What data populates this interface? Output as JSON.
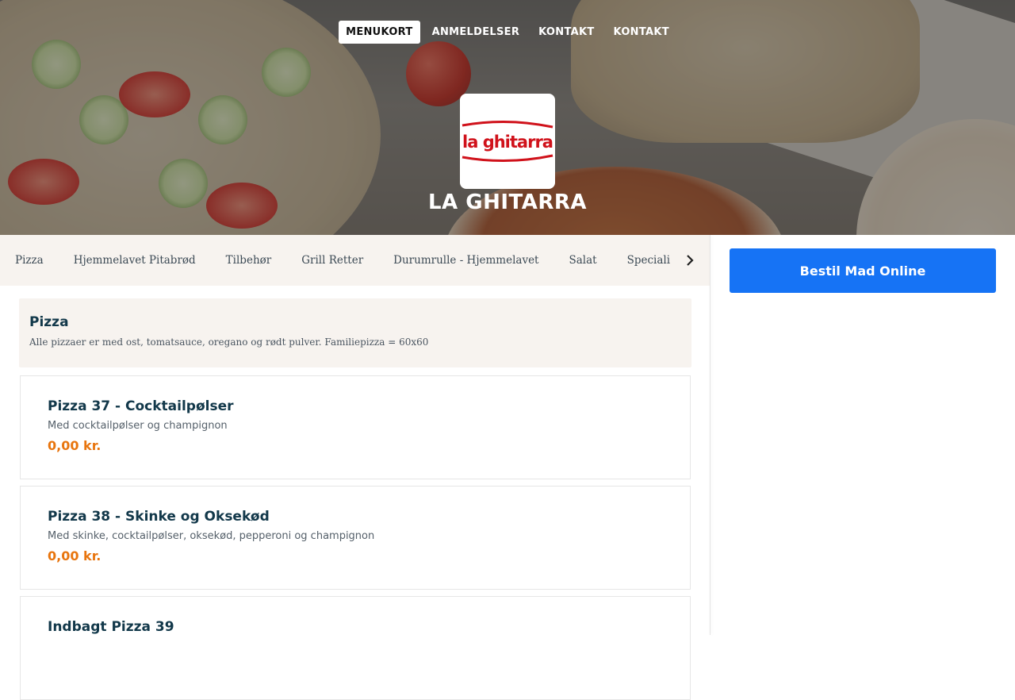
{
  "nav": {
    "items": [
      {
        "label": "MENUKORT",
        "active": true
      },
      {
        "label": "ANMELDELSER",
        "active": false
      },
      {
        "label": "KONTAKT",
        "active": false
      },
      {
        "label": "KONTAKT",
        "active": false
      }
    ]
  },
  "restaurant": {
    "logo_text": "la ghitarra",
    "name": "LA GHITARRA"
  },
  "categories": [
    "Pizza",
    "Hjemmelavet Pitabrød",
    "Tilbehør",
    "Grill Retter",
    "Durumrulle - Hjemmelavet",
    "Salat",
    "Specialite"
  ],
  "category_arrow_icon": "chevron-right-icon",
  "section": {
    "title": "Pizza",
    "description": "Alle pizzaer er med ost, tomatsauce, oregano og rødt pulver. Familiepizza = 60x60"
  },
  "items": [
    {
      "name": "Pizza 37 - Cocktailpølser",
      "description": "Med cocktailpølser og champignon",
      "price": "0,00 kr."
    },
    {
      "name": "Pizza 38 - Skinke og Oksekød",
      "description": "Med skinke, cocktailpølser, oksekød, pepperoni og champignon",
      "price": "0,00 kr."
    },
    {
      "name": "Indbagt Pizza 39",
      "description": "",
      "price": ""
    }
  ],
  "order": {
    "button_label": "Bestil Mad Online"
  },
  "colors": {
    "order_button": "#1673f5",
    "price": "#e8750e",
    "heading": "#12384a",
    "logo_red": "#d0121b"
  }
}
